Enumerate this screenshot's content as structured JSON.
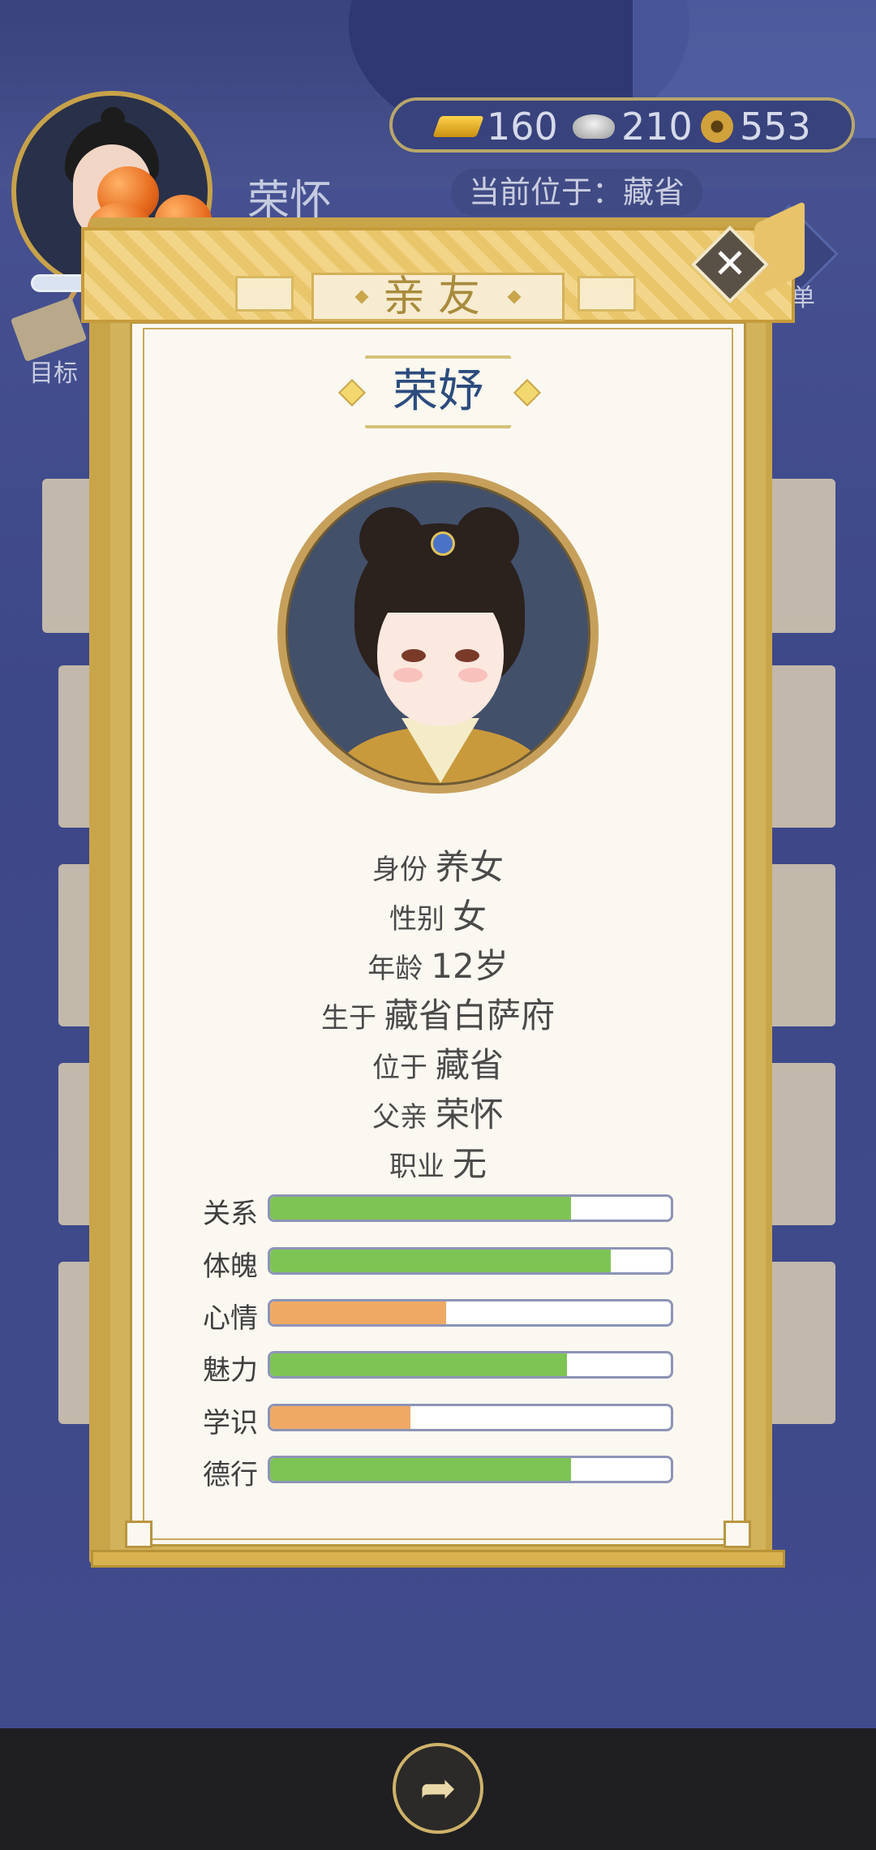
{
  "player": {
    "name": "荣怀"
  },
  "resources": {
    "gold": "160",
    "silver": "210",
    "coins": "553"
  },
  "location_text": "当前位于：藏省",
  "goal_label": "目标",
  "menu_label": "菜单",
  "modal": {
    "title": "亲友",
    "close_symbol": "✕",
    "person_name": "荣妤",
    "info": [
      {
        "key": "身份",
        "value": "养女"
      },
      {
        "key": "性别",
        "value": "女"
      },
      {
        "key": "年龄",
        "value": "12岁"
      },
      {
        "key": "生于",
        "value": "藏省白萨府"
      },
      {
        "key": "位于",
        "value": "藏省"
      },
      {
        "key": "父亲",
        "value": "荣怀"
      },
      {
        "key": "职业",
        "value": "无"
      }
    ],
    "stats": [
      {
        "label": "关系",
        "level": 0.75,
        "color": "#7ec455"
      },
      {
        "label": "体魄",
        "level": 0.85,
        "color": "#7ec455"
      },
      {
        "label": "心情",
        "level": 0.44,
        "color": "#f0a965"
      },
      {
        "label": "魅力",
        "level": 0.74,
        "color": "#7ec455"
      },
      {
        "label": "学识",
        "level": 0.35,
        "color": "#f0a965"
      },
      {
        "label": "德行",
        "level": 0.75,
        "color": "#7ec455"
      }
    ]
  },
  "nav": {
    "share_icon": "share-icon"
  }
}
